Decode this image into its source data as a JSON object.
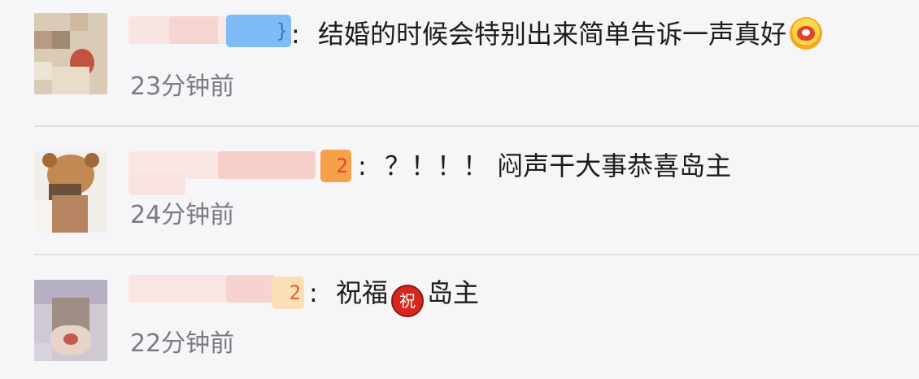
{
  "comments": [
    {
      "separator": ":",
      "text": "结婚的时候会特别出来简单告诉一声真好",
      "emoji": "laughing-face-emoji",
      "time": "23分钟前",
      "badge": "}"
    },
    {
      "separator": ":",
      "text": "？！！！ 闷声干大事恭喜岛主",
      "time": "24分钟前",
      "badge": "2"
    },
    {
      "separator": ":",
      "text_before": "祝福",
      "emoji_text": "祝",
      "text_after": "岛主",
      "time": "22分钟前",
      "badge": "2"
    }
  ],
  "colors": {
    "background": "#f6f6f8",
    "text": "#1c1c1c",
    "time": "#7b7b82",
    "divider": "#e1e1e5",
    "badge_blue": "#6fb3f5",
    "badge_orange": "#f39a3b"
  }
}
